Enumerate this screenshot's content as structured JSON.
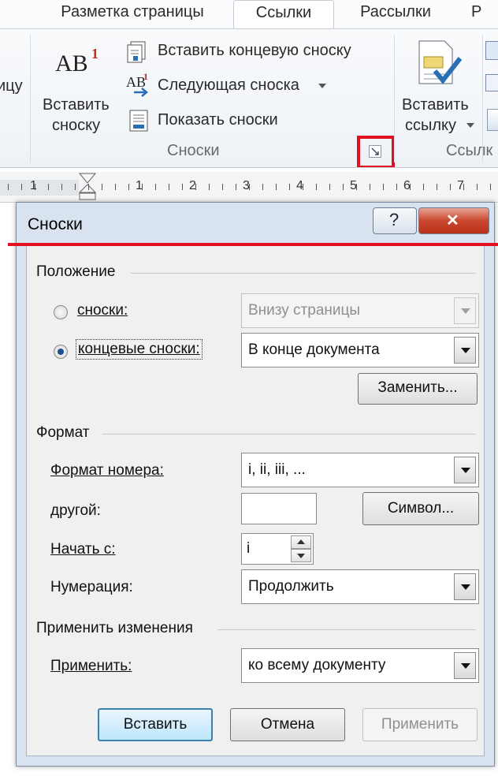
{
  "ribbon": {
    "tabs": [
      "Разметка страницы",
      "Ссылки",
      "Рассылки",
      "Р"
    ],
    "left_cut_text": "ицу",
    "insert_footnote_line1": "Вставить",
    "insert_footnote_line2": "сноску",
    "insert_endnote": "Вставить концевую сноску",
    "next_footnote": "Следующая сноска",
    "show_notes": "Показать сноски",
    "group_footnotes": "Сноски",
    "insert_citation_line1": "Вставить",
    "insert_citation_line2": "ссылку",
    "group_citations": "Ссылк",
    "ab_glyph": "AB",
    "ab_sup": "1",
    "ab_small": "AB",
    "ab_small_sup": "1"
  },
  "ruler": {
    "numbers": [
      "1",
      "1",
      "2",
      "3",
      "4",
      "5",
      "6",
      "7"
    ]
  },
  "dialog": {
    "title": "Сноски",
    "help_glyph": "?",
    "close_glyph": "✕",
    "position": {
      "section": "Положение",
      "footnotes_label": "сноски:",
      "footnotes_value": "Внизу страницы",
      "endnotes_label": "концевые сноски:",
      "endnotes_value": "В конце документа",
      "selected": "endnotes",
      "replace_button": "Заменить..."
    },
    "format": {
      "section": "Формат",
      "number_format_label": "Формат номера:",
      "number_format_value": "i, ii, iii, ...",
      "custom_label": "другой:",
      "custom_value": "",
      "symbol_button": "Символ...",
      "start_label": "Начать с:",
      "start_value": "i",
      "numbering_label": "Нумерация:",
      "numbering_value": "Продолжить"
    },
    "apply_changes": {
      "section": "Применить изменения",
      "apply_label": "Применить:",
      "apply_value": "ко всему документу"
    },
    "buttons": {
      "insert": "Вставить",
      "cancel": "Отмена",
      "apply": "Применить"
    }
  },
  "colors": {
    "highlight_red": "#e01020",
    "accent_blue": "#3c7fb1"
  }
}
